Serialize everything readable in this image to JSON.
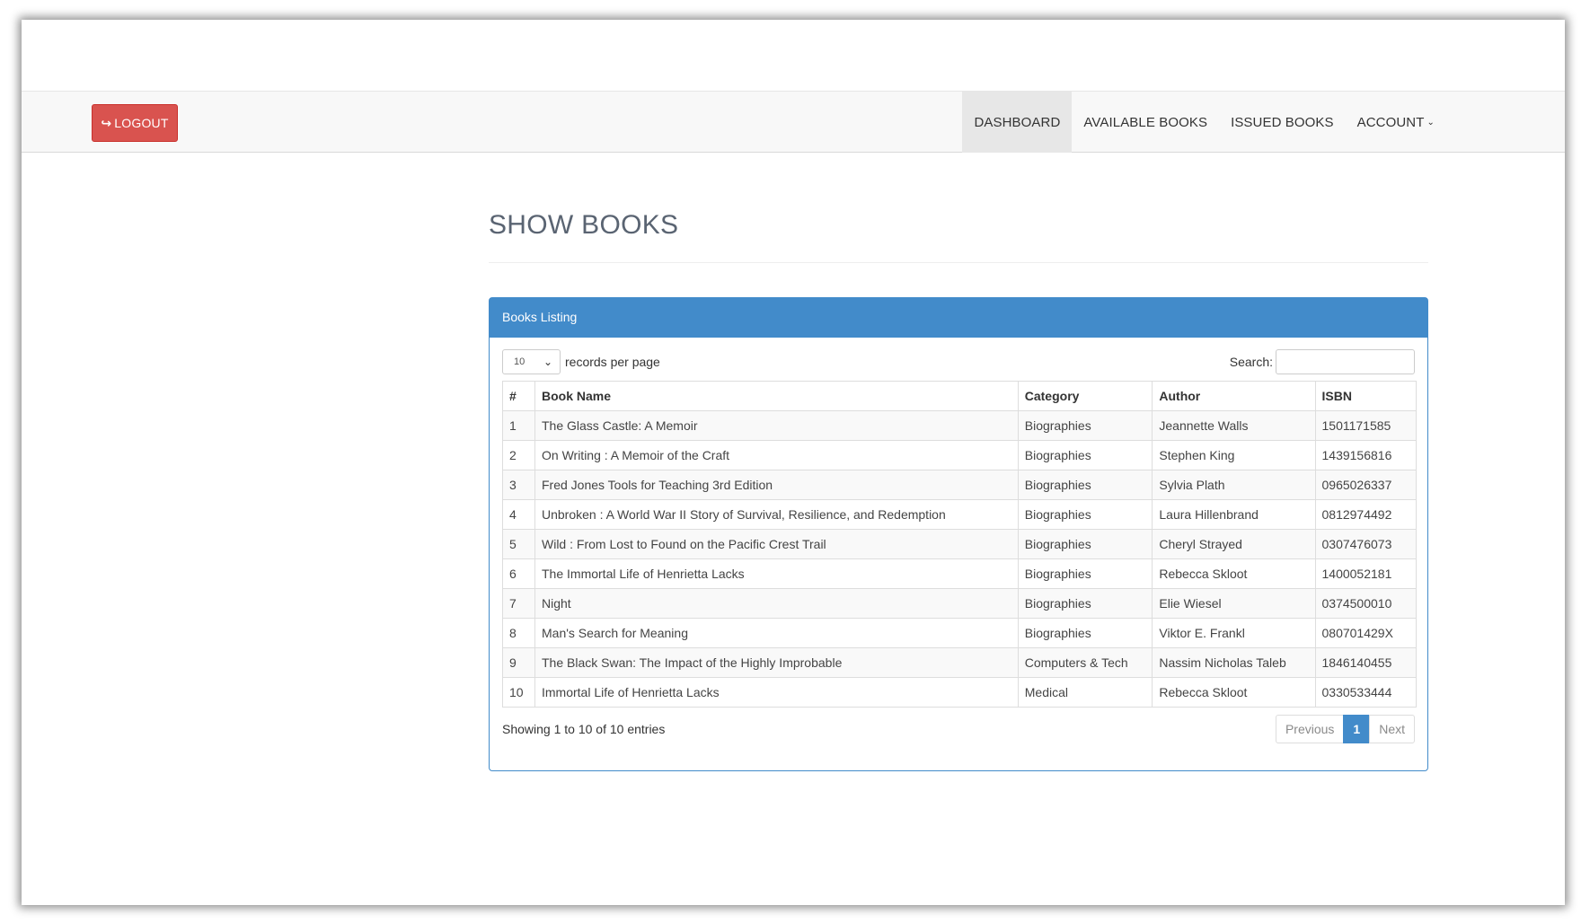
{
  "navbar": {
    "logout_label": "LOGOUT",
    "menu": [
      {
        "label": "DASHBOARD",
        "active": true
      },
      {
        "label": "AVAILABLE BOOKS",
        "active": false
      },
      {
        "label": "ISSUED BOOKS",
        "active": false
      },
      {
        "label": "ACCOUNT",
        "active": false
      }
    ]
  },
  "page": {
    "title": "SHOW BOOKS"
  },
  "panel": {
    "heading": "Books Listing",
    "length_value": "10",
    "length_label": "records per page",
    "search_label": "Search:",
    "search_value": "",
    "columns": [
      "#",
      "Book Name",
      "Category",
      "Author",
      "ISBN"
    ],
    "rows": [
      [
        "1",
        "The Glass Castle: A Memoir",
        "Biographies",
        "Jeannette Walls",
        "1501171585"
      ],
      [
        "2",
        "On Writing : A Memoir of the Craft",
        "Biographies",
        "Stephen King",
        "1439156816"
      ],
      [
        "3",
        "Fred Jones Tools for Teaching 3rd Edition",
        "Biographies",
        "Sylvia Plath",
        "0965026337"
      ],
      [
        "4",
        "Unbroken : A World War II Story of Survival, Resilience, and Redemption",
        "Biographies",
        "Laura Hillenbrand",
        "0812974492"
      ],
      [
        "5",
        "Wild : From Lost to Found on the Pacific Crest Trail",
        "Biographies",
        "Cheryl Strayed",
        "0307476073"
      ],
      [
        "6",
        "The Immortal Life of Henrietta Lacks",
        "Biographies",
        "Rebecca Skloot",
        "1400052181"
      ],
      [
        "7",
        "Night",
        "Biographies",
        "Elie Wiesel",
        "0374500010"
      ],
      [
        "8",
        "Man's Search for Meaning",
        "Biographies",
        "Viktor E. Frankl",
        "080701429X"
      ],
      [
        "9",
        "The Black Swan: The Impact of the Highly Improbable",
        "Computers & Tech",
        "Nassim Nicholas Taleb",
        "1846140455"
      ],
      [
        "10",
        "Immortal Life of Henrietta Lacks",
        "Medical",
        "Rebecca Skloot",
        "0330533444"
      ]
    ],
    "info": "Showing 1 to 10 of 10 entries",
    "pagination": {
      "previous": "Previous",
      "current": "1",
      "next": "Next"
    }
  },
  "colors": {
    "primary": "#428bca",
    "danger": "#d9534f",
    "navbar_bg": "#f8f8f8",
    "title": "#5a6472"
  },
  "icons": {
    "logout": "sign-out-icon",
    "account_caret": "chevron-down-icon",
    "select_caret": "chevron-down-icon"
  }
}
